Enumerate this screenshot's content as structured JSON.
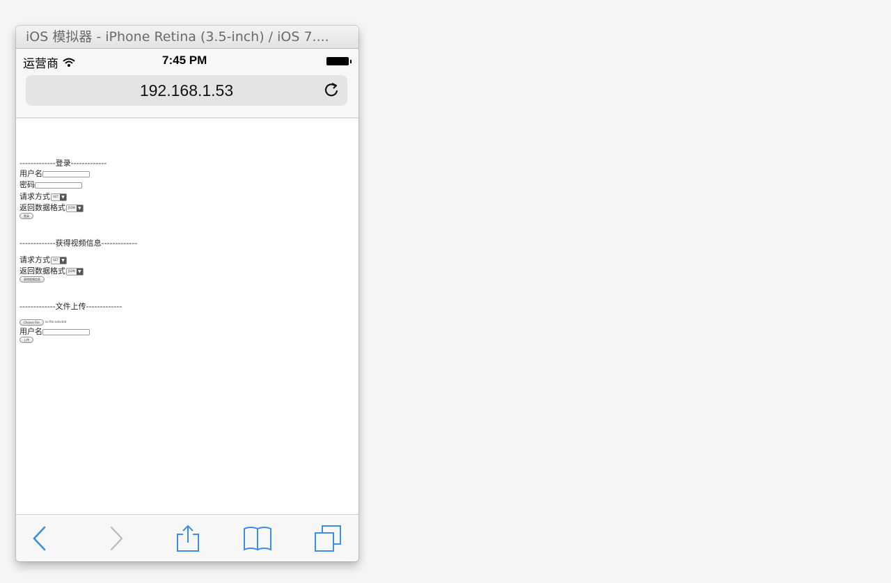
{
  "window": {
    "title": "iOS 模拟器 - iPhone Retina (3.5-inch) / iOS 7...."
  },
  "statusbar": {
    "carrier": "运营商",
    "time": "7:45 PM",
    "wifi_icon": "wifi-icon",
    "battery_icon": "battery-icon"
  },
  "browser": {
    "url": "192.168.1.53",
    "reload_icon": "reload-icon"
  },
  "page": {
    "login": {
      "header": "-------------登录-------------",
      "username_label": "用户名",
      "password_label": "密码",
      "method_label": "请求方式",
      "method_value": "GET",
      "format_label": "返回数据格式",
      "format_value": "JSON",
      "submit_label": "登录"
    },
    "video": {
      "header": "-------------获得视频信息-------------",
      "method_label": "请求方式",
      "method_value": "GET",
      "format_label": "返回数据格式",
      "format_value": "JSON",
      "submit_label": "获得视频信息"
    },
    "upload": {
      "header": "-------------文件上传-------------",
      "choose_label": "Choose File",
      "no_file": "no file selected",
      "username_label": "用户名",
      "submit_label": "上传"
    }
  },
  "toolbar": {
    "back_icon": "back-icon",
    "forward_icon": "forward-icon",
    "share_icon": "share-icon",
    "bookmarks_icon": "bookmarks-icon",
    "tabs_icon": "tabs-icon",
    "accent": "#3a8ee6",
    "disabled": "#b9b9b9"
  }
}
